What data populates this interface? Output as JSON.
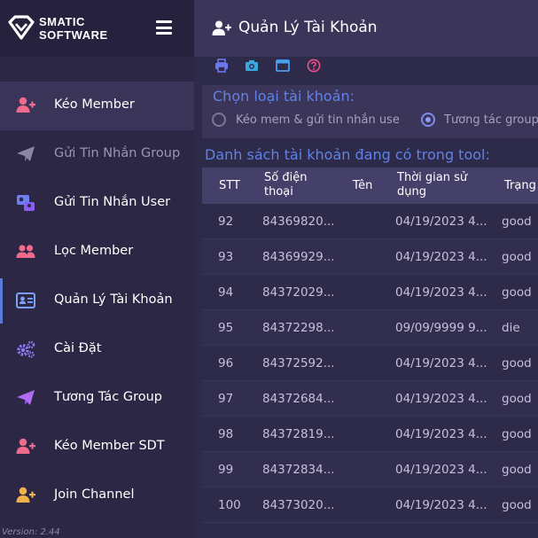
{
  "brand": {
    "line1": "SMATIC",
    "line2": "SOFTWARE"
  },
  "sidebar": {
    "items": [
      {
        "label": "Kéo Member",
        "icon": "user-plus-icon"
      },
      {
        "label": "Gửi Tin Nhắn Group",
        "icon": "paper-plane-icon"
      },
      {
        "label": "Gửi Tin Nhắn User",
        "icon": "user-message-icon"
      },
      {
        "label": "Lọc Member",
        "icon": "users-icon"
      },
      {
        "label": "Quản Lý Tài Khoản",
        "icon": "id-card-icon"
      },
      {
        "label": "Cài Đặt",
        "icon": "gears-icon"
      },
      {
        "label": "Tương Tác Group",
        "icon": "paper-plane-icon"
      },
      {
        "label": "Kéo Member SDT",
        "icon": "user-plus-icon"
      },
      {
        "label": "Join Channel",
        "icon": "user-plus-icon"
      }
    ],
    "version": "Version: 2.44"
  },
  "header": {
    "title": "Quản Lý Tài Khoản"
  },
  "account_type": {
    "title": "Chọn loại tài khoản:",
    "options": [
      {
        "label": "Kéo mem & gửi tin nhắn use",
        "selected": false
      },
      {
        "label": "Tương tác group",
        "selected": true
      }
    ]
  },
  "list_title": "Danh sách tài khoản đang có trong tool:",
  "table": {
    "headers": {
      "stt": "STT",
      "phone_1": "Số điện",
      "phone_2": "thoại",
      "name": "Tên",
      "time_1": "Thời gian sử",
      "time_2": "dụng",
      "status": "Trạng"
    },
    "rows": [
      {
        "stt": "92",
        "phone": "84369820...",
        "name": "",
        "time": "04/19/2023 4...",
        "status": "good"
      },
      {
        "stt": "93",
        "phone": "84369929...",
        "name": "",
        "time": "04/19/2023 4...",
        "status": "good"
      },
      {
        "stt": "94",
        "phone": "84372029...",
        "name": "",
        "time": "04/19/2023 4...",
        "status": "good"
      },
      {
        "stt": "95",
        "phone": "84372298...",
        "name": "",
        "time": "09/09/9999 9...",
        "status": "die"
      },
      {
        "stt": "96",
        "phone": "84372592...",
        "name": "",
        "time": "04/19/2023 4...",
        "status": "good"
      },
      {
        "stt": "97",
        "phone": "84372684...",
        "name": "",
        "time": "04/19/2023 4...",
        "status": "good"
      },
      {
        "stt": "98",
        "phone": "84372819...",
        "name": "",
        "time": "04/19/2023 4...",
        "status": "good"
      },
      {
        "stt": "99",
        "phone": "84372834...",
        "name": "",
        "time": "04/19/2023 4...",
        "status": "good"
      },
      {
        "stt": "100",
        "phone": "84373020...",
        "name": "",
        "time": "04/19/2023 4...",
        "status": "good"
      }
    ]
  },
  "colors": {
    "accent": "#5f82e6",
    "sidebar_bg": "#2b2744",
    "header_bg": "#3a3559",
    "icon_pink": "#f06a8e",
    "icon_purple": "#a56ef0"
  }
}
